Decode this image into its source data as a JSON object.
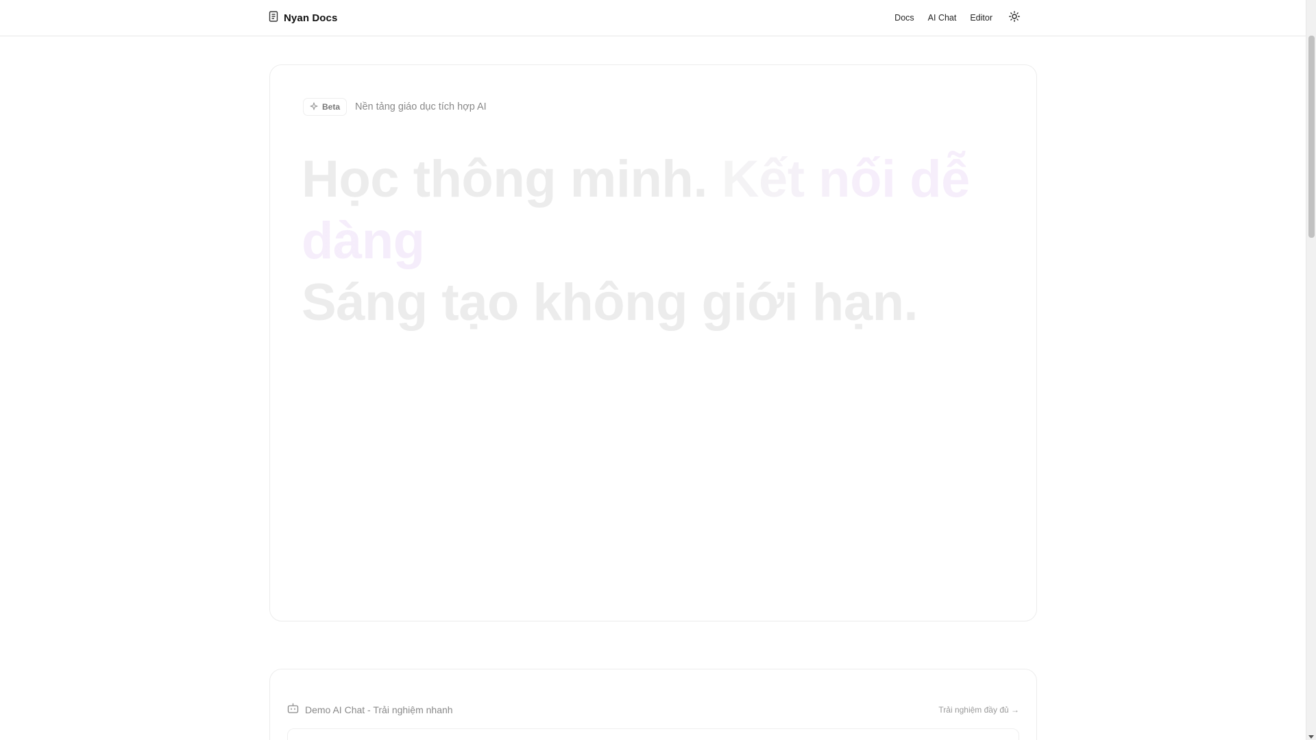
{
  "header": {
    "brand": "Nyan Docs",
    "nav": [
      {
        "label": "Docs"
      },
      {
        "label": "AI Chat"
      },
      {
        "label": "Editor"
      }
    ],
    "theme_icon": "sun-icon"
  },
  "hero": {
    "badge": "Beta",
    "badge_icon": "sparkle-icon",
    "tagline": "Nền tảng giáo dục tích hợp AI",
    "headline_part1": "Học thông minh.",
    "headline_part2": "Kết nối dễ dàng",
    "headline_line2": "Sáng tạo không giới hạn."
  },
  "demo": {
    "icon": "bot-icon",
    "title": "Demo AI Chat - Trải nghiệm nhanh",
    "link": "Trải nghiệm đầy đủ →"
  },
  "colors": {
    "border": "#ececec",
    "text_muted": "#888888",
    "headline_faded": "#ececec",
    "accent_faded": "#f5edfb"
  }
}
